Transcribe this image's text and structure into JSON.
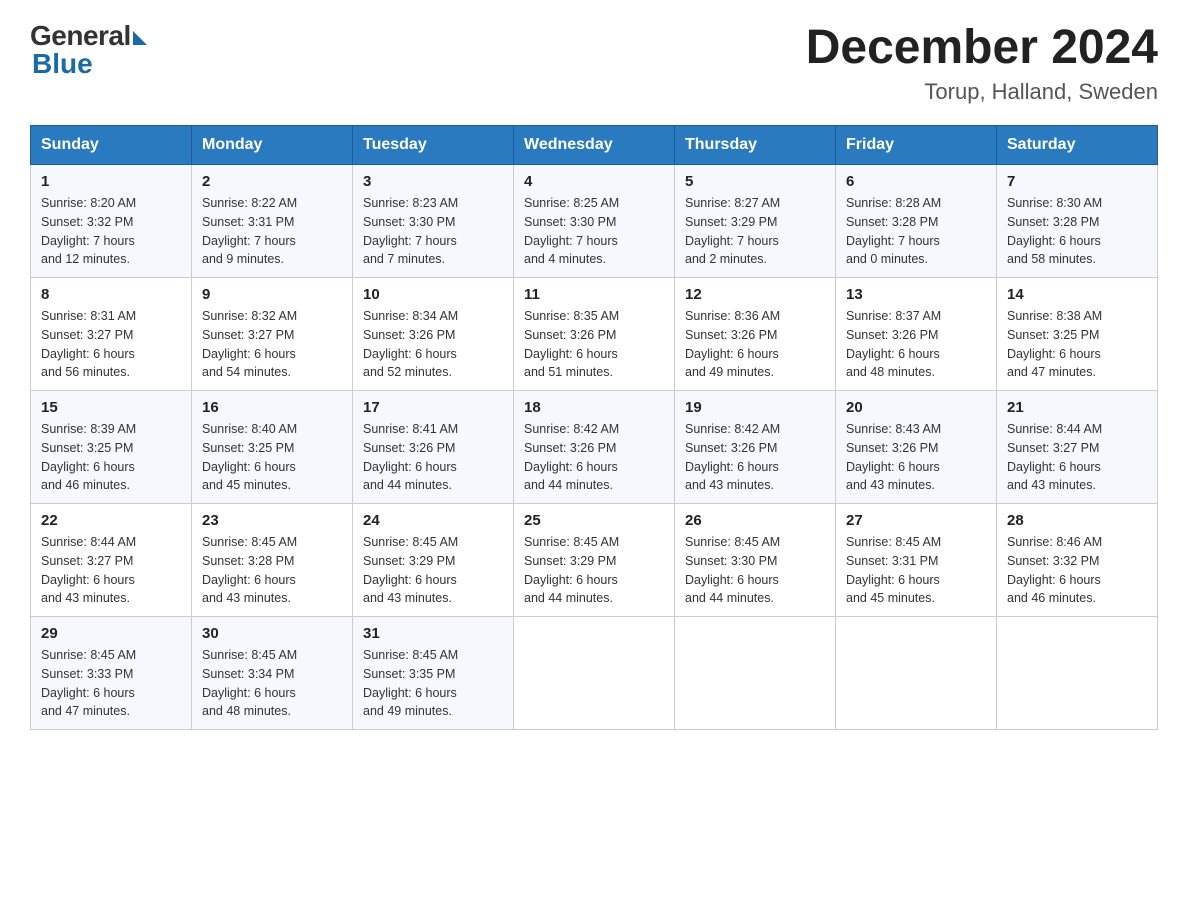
{
  "header": {
    "logo_general": "General",
    "logo_blue": "Blue",
    "month_title": "December 2024",
    "location": "Torup, Halland, Sweden"
  },
  "days_of_week": [
    "Sunday",
    "Monday",
    "Tuesday",
    "Wednesday",
    "Thursday",
    "Friday",
    "Saturday"
  ],
  "weeks": [
    [
      {
        "day": "1",
        "sunrise": "Sunrise: 8:20 AM",
        "sunset": "Sunset: 3:32 PM",
        "daylight": "Daylight: 7 hours",
        "minutes": "and 12 minutes."
      },
      {
        "day": "2",
        "sunrise": "Sunrise: 8:22 AM",
        "sunset": "Sunset: 3:31 PM",
        "daylight": "Daylight: 7 hours",
        "minutes": "and 9 minutes."
      },
      {
        "day": "3",
        "sunrise": "Sunrise: 8:23 AM",
        "sunset": "Sunset: 3:30 PM",
        "daylight": "Daylight: 7 hours",
        "minutes": "and 7 minutes."
      },
      {
        "day": "4",
        "sunrise": "Sunrise: 8:25 AM",
        "sunset": "Sunset: 3:30 PM",
        "daylight": "Daylight: 7 hours",
        "minutes": "and 4 minutes."
      },
      {
        "day": "5",
        "sunrise": "Sunrise: 8:27 AM",
        "sunset": "Sunset: 3:29 PM",
        "daylight": "Daylight: 7 hours",
        "minutes": "and 2 minutes."
      },
      {
        "day": "6",
        "sunrise": "Sunrise: 8:28 AM",
        "sunset": "Sunset: 3:28 PM",
        "daylight": "Daylight: 7 hours",
        "minutes": "and 0 minutes."
      },
      {
        "day": "7",
        "sunrise": "Sunrise: 8:30 AM",
        "sunset": "Sunset: 3:28 PM",
        "daylight": "Daylight: 6 hours",
        "minutes": "and 58 minutes."
      }
    ],
    [
      {
        "day": "8",
        "sunrise": "Sunrise: 8:31 AM",
        "sunset": "Sunset: 3:27 PM",
        "daylight": "Daylight: 6 hours",
        "minutes": "and 56 minutes."
      },
      {
        "day": "9",
        "sunrise": "Sunrise: 8:32 AM",
        "sunset": "Sunset: 3:27 PM",
        "daylight": "Daylight: 6 hours",
        "minutes": "and 54 minutes."
      },
      {
        "day": "10",
        "sunrise": "Sunrise: 8:34 AM",
        "sunset": "Sunset: 3:26 PM",
        "daylight": "Daylight: 6 hours",
        "minutes": "and 52 minutes."
      },
      {
        "day": "11",
        "sunrise": "Sunrise: 8:35 AM",
        "sunset": "Sunset: 3:26 PM",
        "daylight": "Daylight: 6 hours",
        "minutes": "and 51 minutes."
      },
      {
        "day": "12",
        "sunrise": "Sunrise: 8:36 AM",
        "sunset": "Sunset: 3:26 PM",
        "daylight": "Daylight: 6 hours",
        "minutes": "and 49 minutes."
      },
      {
        "day": "13",
        "sunrise": "Sunrise: 8:37 AM",
        "sunset": "Sunset: 3:26 PM",
        "daylight": "Daylight: 6 hours",
        "minutes": "and 48 minutes."
      },
      {
        "day": "14",
        "sunrise": "Sunrise: 8:38 AM",
        "sunset": "Sunset: 3:25 PM",
        "daylight": "Daylight: 6 hours",
        "minutes": "and 47 minutes."
      }
    ],
    [
      {
        "day": "15",
        "sunrise": "Sunrise: 8:39 AM",
        "sunset": "Sunset: 3:25 PM",
        "daylight": "Daylight: 6 hours",
        "minutes": "and 46 minutes."
      },
      {
        "day": "16",
        "sunrise": "Sunrise: 8:40 AM",
        "sunset": "Sunset: 3:25 PM",
        "daylight": "Daylight: 6 hours",
        "minutes": "and 45 minutes."
      },
      {
        "day": "17",
        "sunrise": "Sunrise: 8:41 AM",
        "sunset": "Sunset: 3:26 PM",
        "daylight": "Daylight: 6 hours",
        "minutes": "and 44 minutes."
      },
      {
        "day": "18",
        "sunrise": "Sunrise: 8:42 AM",
        "sunset": "Sunset: 3:26 PM",
        "daylight": "Daylight: 6 hours",
        "minutes": "and 44 minutes."
      },
      {
        "day": "19",
        "sunrise": "Sunrise: 8:42 AM",
        "sunset": "Sunset: 3:26 PM",
        "daylight": "Daylight: 6 hours",
        "minutes": "and 43 minutes."
      },
      {
        "day": "20",
        "sunrise": "Sunrise: 8:43 AM",
        "sunset": "Sunset: 3:26 PM",
        "daylight": "Daylight: 6 hours",
        "minutes": "and 43 minutes."
      },
      {
        "day": "21",
        "sunrise": "Sunrise: 8:44 AM",
        "sunset": "Sunset: 3:27 PM",
        "daylight": "Daylight: 6 hours",
        "minutes": "and 43 minutes."
      }
    ],
    [
      {
        "day": "22",
        "sunrise": "Sunrise: 8:44 AM",
        "sunset": "Sunset: 3:27 PM",
        "daylight": "Daylight: 6 hours",
        "minutes": "and 43 minutes."
      },
      {
        "day": "23",
        "sunrise": "Sunrise: 8:45 AM",
        "sunset": "Sunset: 3:28 PM",
        "daylight": "Daylight: 6 hours",
        "minutes": "and 43 minutes."
      },
      {
        "day": "24",
        "sunrise": "Sunrise: 8:45 AM",
        "sunset": "Sunset: 3:29 PM",
        "daylight": "Daylight: 6 hours",
        "minutes": "and 43 minutes."
      },
      {
        "day": "25",
        "sunrise": "Sunrise: 8:45 AM",
        "sunset": "Sunset: 3:29 PM",
        "daylight": "Daylight: 6 hours",
        "minutes": "and 44 minutes."
      },
      {
        "day": "26",
        "sunrise": "Sunrise: 8:45 AM",
        "sunset": "Sunset: 3:30 PM",
        "daylight": "Daylight: 6 hours",
        "minutes": "and 44 minutes."
      },
      {
        "day": "27",
        "sunrise": "Sunrise: 8:45 AM",
        "sunset": "Sunset: 3:31 PM",
        "daylight": "Daylight: 6 hours",
        "minutes": "and 45 minutes."
      },
      {
        "day": "28",
        "sunrise": "Sunrise: 8:46 AM",
        "sunset": "Sunset: 3:32 PM",
        "daylight": "Daylight: 6 hours",
        "minutes": "and 46 minutes."
      }
    ],
    [
      {
        "day": "29",
        "sunrise": "Sunrise: 8:45 AM",
        "sunset": "Sunset: 3:33 PM",
        "daylight": "Daylight: 6 hours",
        "minutes": "and 47 minutes."
      },
      {
        "day": "30",
        "sunrise": "Sunrise: 8:45 AM",
        "sunset": "Sunset: 3:34 PM",
        "daylight": "Daylight: 6 hours",
        "minutes": "and 48 minutes."
      },
      {
        "day": "31",
        "sunrise": "Sunrise: 8:45 AM",
        "sunset": "Sunset: 3:35 PM",
        "daylight": "Daylight: 6 hours",
        "minutes": "and 49 minutes."
      },
      null,
      null,
      null,
      null
    ]
  ]
}
